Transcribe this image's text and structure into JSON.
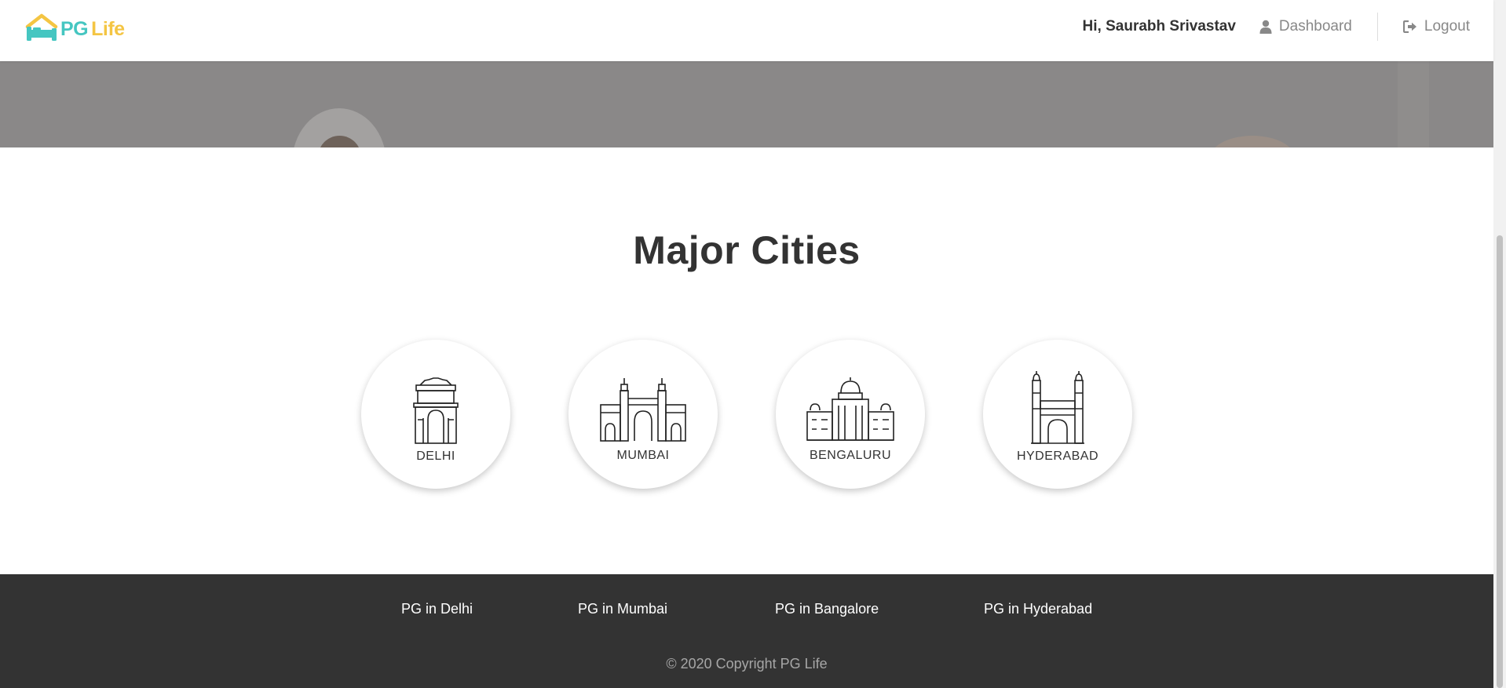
{
  "brand": {
    "part1": "PG",
    "part2": "Life",
    "teal": "#45c6c1",
    "yellow": "#f4c543"
  },
  "header": {
    "greeting": "Hi, Saurabh Srivastav",
    "dashboard_label": "Dashboard",
    "logout_label": "Logout",
    "dashboard_icon": "user-icon",
    "logout_icon": "sign-out-icon"
  },
  "main": {
    "title": "Major Cities",
    "cities": [
      {
        "name": "DELHI",
        "icon": "india-gate-icon"
      },
      {
        "name": "MUMBAI",
        "icon": "gateway-of-india-icon"
      },
      {
        "name": "BENGALURU",
        "icon": "vidhana-soudha-icon"
      },
      {
        "name": "HYDERABAD",
        "icon": "charminar-icon"
      }
    ]
  },
  "footer": {
    "links": [
      "PG in Delhi",
      "PG in Mumbai",
      "PG in Bangalore",
      "PG in Hyderabad"
    ],
    "copyright": "© 2020 Copyright PG Life",
    "background": "#333333"
  }
}
